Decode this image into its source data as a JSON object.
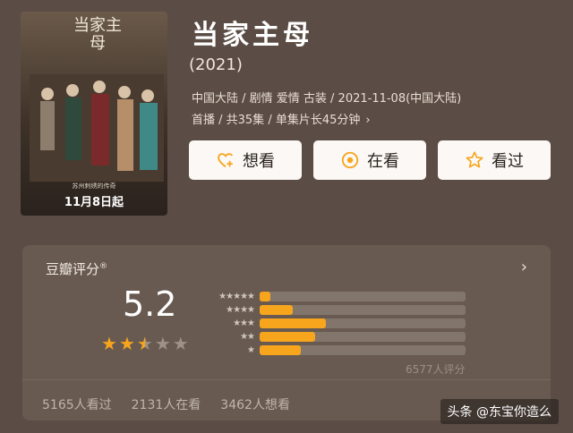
{
  "poster": {
    "title": "当家主母",
    "subtitle": "苏州刺绣的传奇",
    "date": "11月8日起"
  },
  "movie": {
    "title": "当家主母",
    "year": "(2021)",
    "meta_line1": "中国大陆 / 剧情 爱情 古装 / 2021-11-08(中国大陆)",
    "meta_line2": "首播 / 共35集 / 单集片长45分钟",
    "chevron": "›"
  },
  "actions": {
    "want_label": "想看",
    "watching_label": "在看",
    "watched_label": "看过"
  },
  "rating": {
    "title": "豆瓣评分",
    "registered_mark": "®",
    "chevron": "›",
    "score": "5.2",
    "stars_value": 2.5,
    "stars_max": 5,
    "distribution": [
      {
        "label": "★★★★★",
        "fraction": 0.05
      },
      {
        "label": "★★★★",
        "fraction": 0.16
      },
      {
        "label": "★★★",
        "fraction": 0.32
      },
      {
        "label": "★★",
        "fraction": 0.27
      },
      {
        "label": "★",
        "fraction": 0.2
      }
    ],
    "count": "6577人评分"
  },
  "stats": {
    "watched": "5165人看过",
    "watching": "2131人在看",
    "want": "3462人想看"
  },
  "watermark": "头条 @东宝你造么",
  "colors": {
    "background": "#5b4d45",
    "card": "#685a51",
    "accent": "#f7a51d",
    "button_bg": "#fbf8f5"
  },
  "icons": [
    "heart-plus-icon",
    "target-icon",
    "star-outline-icon",
    "chevron-right-icon"
  ]
}
